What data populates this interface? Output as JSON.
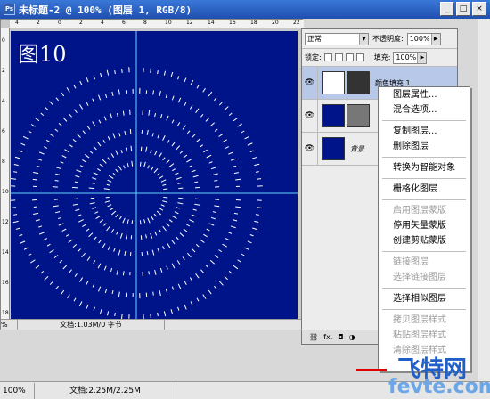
{
  "window": {
    "title": "未标题-2 @ 100% (图层 1, RGB/8)",
    "app_icon": "Ps",
    "controls": [
      "_",
      "□",
      "×"
    ]
  },
  "rulers": {
    "h_ticks": [
      "4",
      "2",
      "0",
      "2",
      "4",
      "6",
      "8",
      "10",
      "12",
      "14",
      "16",
      "18",
      "20",
      "22"
    ],
    "v_ticks": [
      "0",
      "2",
      "4",
      "6",
      "8",
      "10",
      "12",
      "14",
      "16",
      "18"
    ]
  },
  "canvas": {
    "label": "图10",
    "bg_color": "#00148a",
    "guide_color": "#62d6ff",
    "rings": [
      {
        "radius_frac": 0.18,
        "dash_count": 44
      },
      {
        "radius_frac": 0.28,
        "dash_count": 56
      },
      {
        "radius_frac": 0.39,
        "dash_count": 68
      },
      {
        "radius_frac": 0.52,
        "dash_count": 80
      },
      {
        "radius_frac": 0.66,
        "dash_count": 94
      },
      {
        "radius_frac": 0.8,
        "dash_count": 108
      }
    ]
  },
  "doc_status": {
    "zoom": "%",
    "info": "文档:1.03M/0 字节"
  },
  "layers_panel": {
    "blend_mode": "正常",
    "opacity_label": "不透明度:",
    "opacity_value": "100%",
    "lock_label": "锁定:",
    "fill_label": "填充:",
    "fill_value": "100%",
    "layers": [
      {
        "name": "颜色填充 1",
        "selected": true
      },
      {
        "name": "",
        "selected": false
      },
      {
        "name": "背景",
        "selected": false
      }
    ],
    "bottom_icons": [
      "link-icon",
      "fx-icon",
      "mask-icon",
      "adjustment-icon"
    ],
    "fx_label": "fx."
  },
  "context_menu": {
    "groups": [
      [
        {
          "label": "图层属性...",
          "enabled": true
        },
        {
          "label": "混合选项...",
          "enabled": true
        }
      ],
      [
        {
          "label": "复制图层...",
          "enabled": true
        },
        {
          "label": "删除图层",
          "enabled": true
        }
      ],
      [
        {
          "label": "转换为智能对象",
          "enabled": true
        }
      ],
      [
        {
          "label": "栅格化图层",
          "enabled": true
        }
      ],
      [
        {
          "label": "启用图层蒙版",
          "enabled": false
        },
        {
          "label": "停用矢量蒙版",
          "enabled": true
        },
        {
          "label": "创建剪贴蒙版",
          "enabled": true
        }
      ],
      [
        {
          "label": "链接图层",
          "enabled": false
        },
        {
          "label": "选择链接图层",
          "enabled": false
        }
      ],
      [
        {
          "label": "选择相似图层",
          "enabled": true
        }
      ],
      [
        {
          "label": "拷贝图层样式",
          "enabled": false
        },
        {
          "label": "粘贴图层样式",
          "enabled": false
        },
        {
          "label": "清除图层样式",
          "enabled": false
        }
      ]
    ]
  },
  "status_bar": {
    "zoom": "100%",
    "info": "文档:2.25M/2.25M"
  },
  "watermark": {
    "line1": "飞特网",
    "line2": "fevte.com"
  }
}
